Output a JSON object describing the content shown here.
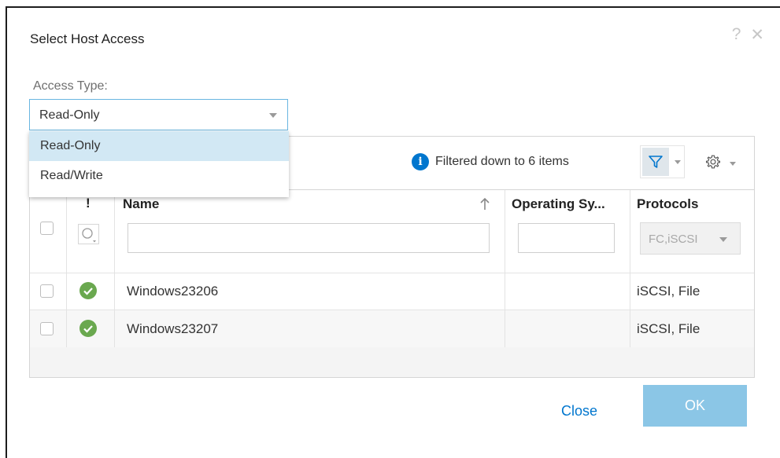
{
  "dialog": {
    "title": "Select Host Access",
    "help_glyph": "?",
    "close_glyph": "✕"
  },
  "access": {
    "label": "Access Type:",
    "selected": "Read-Only",
    "options": [
      "Read-Only",
      "Read/Write"
    ]
  },
  "toolbar": {
    "info_glyph": "i",
    "filtered_text": "Filtered down to 6 items",
    "filter_icon": "funnel-icon",
    "settings_icon": "gear-icon"
  },
  "table": {
    "columns": {
      "status": "!",
      "name": "Name",
      "os": "Operating Sy...",
      "protocols": "Protocols"
    },
    "sort": {
      "column": "Name",
      "direction": "ascending"
    },
    "filters": {
      "name": "",
      "os": "",
      "protocols": "FC,iSCSI"
    },
    "rows": [
      {
        "status": "ok",
        "name": "Windows23206",
        "os": "",
        "protocols": "iSCSI, File"
      },
      {
        "status": "ok",
        "name": "Windows23207",
        "os": "",
        "protocols": "iSCSI, File"
      }
    ]
  },
  "footer": {
    "close_label": "Close",
    "ok_label": "OK"
  },
  "colors": {
    "accent": "#0076ce",
    "ok_disabled": "#8bc6e6",
    "selected_option": "#d2e8f4",
    "status_ok": "#6aa84f"
  }
}
